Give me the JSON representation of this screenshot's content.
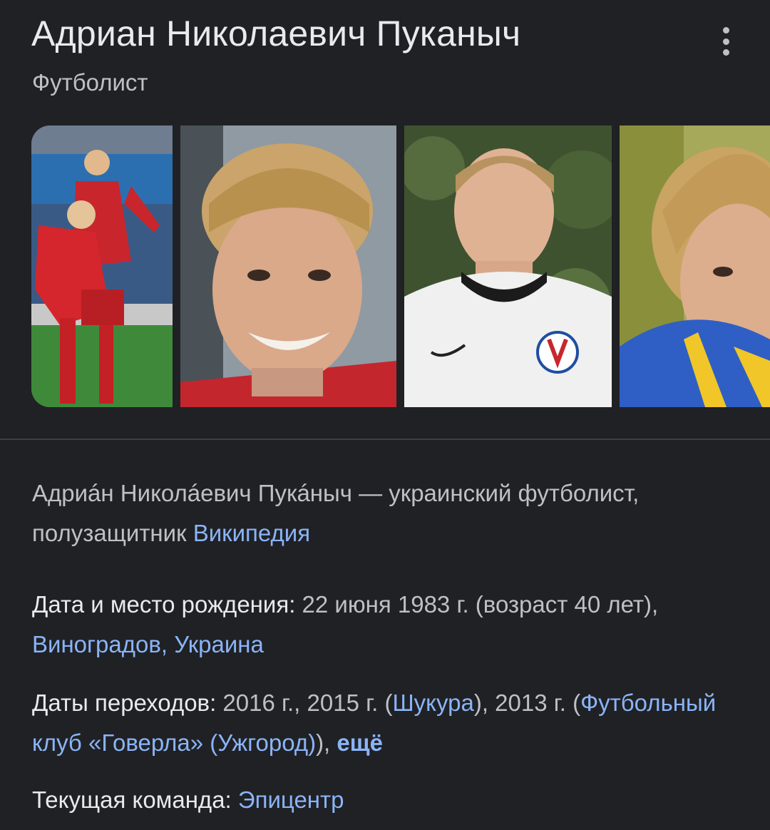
{
  "header": {
    "title": "Адриан Николаевич Пуканыч",
    "subtitle": "Футболист"
  },
  "description": {
    "text": "Адриáн Николáевич Пукáныч — украинский футболист, полузащитник ",
    "source_link": "Википедия"
  },
  "facts": {
    "birth": {
      "label": "Дата и место рождения:",
      "value": " 22 июня 1983 г. (возраст 40 лет), ",
      "link": "Виноградов, Украина"
    },
    "transfers": {
      "label": "Даты переходов:",
      "value_a": " 2016 г., 2015 г. (",
      "link_a": "Шукура",
      "value_b": "), 2013 г. (",
      "link_b": "Футбольный клуб «Говерла» (Ужгород)",
      "value_c": "), ",
      "more": "ещё"
    },
    "team": {
      "label": "Текущая команда:",
      "link": "Эпицентр"
    }
  },
  "colors": {
    "background": "#202124",
    "title": "#e8eaed",
    "secondary_text": "#bdc1c6",
    "link": "#8ab4f8",
    "divider": "#3c4043"
  },
  "icons": {
    "menu": "more-vert-icon"
  }
}
